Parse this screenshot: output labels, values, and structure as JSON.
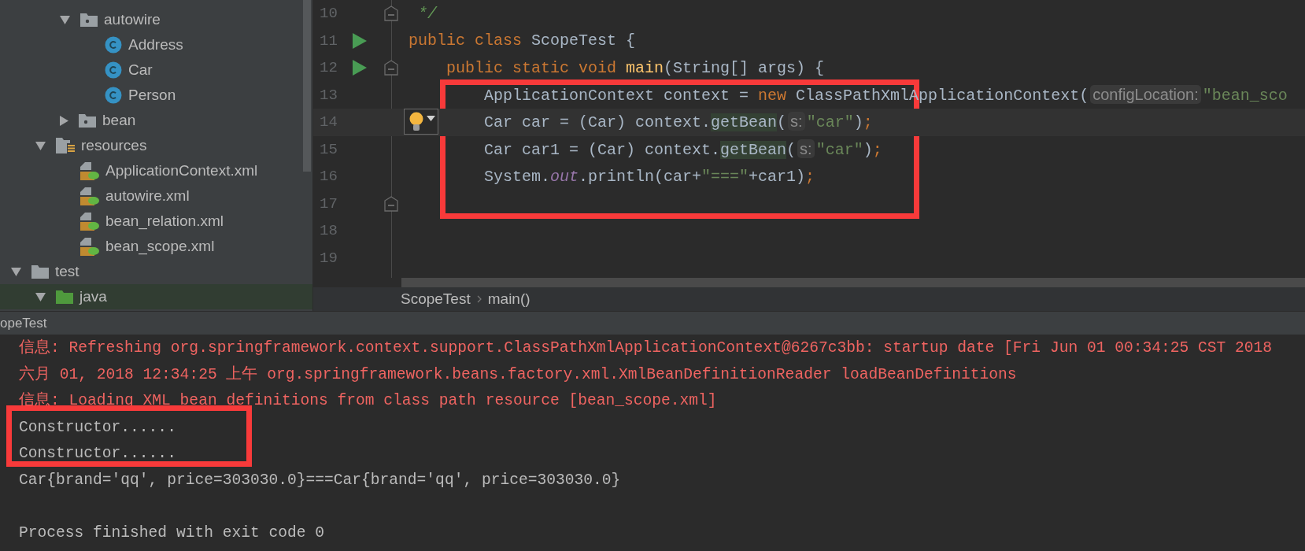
{
  "tree": [
    {
      "children": [
        {
          "children": [
            {
              "label": "autowire",
              "kind": "package",
              "expanded": true,
              "selected": false,
              "children": [
                {
                  "label": "Address",
                  "kind": "class",
                  "selected": false
                },
                {
                  "label": "Car",
                  "kind": "class",
                  "selected": false
                },
                {
                  "label": "Person",
                  "kind": "class",
                  "selected": false
                }
              ]
            },
            {
              "label": "bean",
              "kind": "package",
              "expanded": false,
              "selected": false
            }
          ]
        },
        {
          "label": "resources",
          "kind": "resources",
          "expanded": true,
          "selected": false,
          "children": [
            {
              "label": "ApplicationContext.xml",
              "kind": "xml",
              "selected": false
            },
            {
              "label": "autowire.xml",
              "kind": "xml",
              "selected": false
            },
            {
              "label": "bean_relation.xml",
              "kind": "xml",
              "selected": false
            },
            {
              "label": "bean_scope.xml",
              "kind": "xml",
              "selected": false
            }
          ]
        }
      ]
    },
    {
      "label": "test",
      "kind": "folder",
      "expanded": true,
      "selected": false,
      "children": [
        {
          "label": "java",
          "kind": "source",
          "expanded": true,
          "selected": true
        }
      ]
    }
  ],
  "editor": {
    "lines": [
      {
        "number": "10",
        "run": false,
        "fold": true,
        "current": false,
        "intention": false,
        "tokens": [
          {
            "kind": "comment",
            "text": " */"
          }
        ]
      },
      {
        "number": "11",
        "run": true,
        "fold": false,
        "current": false,
        "intention": false,
        "tokens": [
          {
            "kind": "keyword",
            "text": "public class "
          },
          {
            "kind": "plain",
            "text": "ScopeTest {"
          }
        ]
      },
      {
        "number": "12",
        "run": true,
        "fold": true,
        "current": false,
        "intention": false,
        "tokens": [
          {
            "kind": "keyword",
            "text": "    public static void "
          },
          {
            "kind": "method",
            "text": "main"
          },
          {
            "kind": "plain",
            "text": "(String[] args) {"
          }
        ]
      },
      {
        "number": "13",
        "run": false,
        "fold": false,
        "current": false,
        "intention": false,
        "tokens": [
          {
            "kind": "plain",
            "text": "        ApplicationContext context = "
          },
          {
            "kind": "keyword",
            "text": "new"
          },
          {
            "kind": "plain",
            "text": " ClassPathXmlApplicationContext("
          },
          {
            "kind": "hint",
            "text": "configLocation:"
          },
          {
            "kind": "string",
            "text": "\"bean_sco"
          }
        ]
      },
      {
        "number": "14",
        "run": false,
        "fold": false,
        "current": true,
        "intention": true,
        "tokens": [
          {
            "kind": "plain",
            "text": "        Car car = (Car) context."
          },
          {
            "kind": "usage",
            "text": "getBean"
          },
          {
            "kind": "plain",
            "text": "("
          },
          {
            "kind": "hint",
            "text": "s:"
          },
          {
            "kind": "string",
            "text": "\"car\""
          },
          {
            "kind": "plain",
            "text": ")"
          },
          {
            "kind": "keyword",
            "text": ";"
          }
        ]
      },
      {
        "number": "15",
        "run": false,
        "fold": false,
        "current": false,
        "intention": false,
        "tokens": [
          {
            "kind": "plain",
            "text": "        Car car1 = (Car) context."
          },
          {
            "kind": "usage",
            "text": "getBean"
          },
          {
            "kind": "plain",
            "text": "("
          },
          {
            "kind": "hint",
            "text": "s:"
          },
          {
            "kind": "string",
            "text": "\"car\""
          },
          {
            "kind": "plain",
            "text": ")"
          },
          {
            "kind": "keyword",
            "text": ";"
          }
        ]
      },
      {
        "number": "16",
        "run": false,
        "fold": false,
        "current": false,
        "intention": false,
        "tokens": [
          {
            "kind": "plain",
            "text": "        System."
          },
          {
            "kind": "field",
            "text": "out"
          },
          {
            "kind": "plain",
            "text": ".println(car+"
          },
          {
            "kind": "string",
            "text": "\"===\""
          },
          {
            "kind": "plain",
            "text": "+car1)"
          },
          {
            "kind": "keyword",
            "text": ";"
          }
        ]
      },
      {
        "number": "17",
        "run": false,
        "fold": true,
        "current": false,
        "intention": false
      },
      {
        "number": "18",
        "run": false,
        "fold": false,
        "current": false,
        "intention": false
      },
      {
        "number": "19",
        "run": false,
        "fold": false,
        "current": false,
        "intention": false
      }
    ],
    "breadcrumbs": [
      "ScopeTest",
      "main()"
    ]
  },
  "console": {
    "title": "opeTest",
    "lines": [
      {
        "kind": "error",
        "text": "信息: Refreshing org.springframework.context.support.ClassPathXmlApplicationContext@6267c3bb: startup date [Fri Jun 01 00:34:25 CST 2018"
      },
      {
        "kind": "error",
        "text": "六月 01, 2018 12:34:25 上午 org.springframework.beans.factory.xml.XmlBeanDefinitionReader loadBeanDefinitions"
      },
      {
        "kind": "error",
        "text": "信息: Loading XML bean definitions from class path resource [bean_scope.xml]"
      },
      {
        "kind": "output",
        "text": "Constructor......"
      },
      {
        "kind": "output",
        "text": "Constructor......"
      },
      {
        "kind": "output",
        "text": "Car{brand='qq', price=303030.0}===Car{brand='qq', price=303030.0}"
      },
      {
        "kind": "blank"
      },
      {
        "kind": "output",
        "text": "Process finished with exit code 0"
      }
    ]
  }
}
